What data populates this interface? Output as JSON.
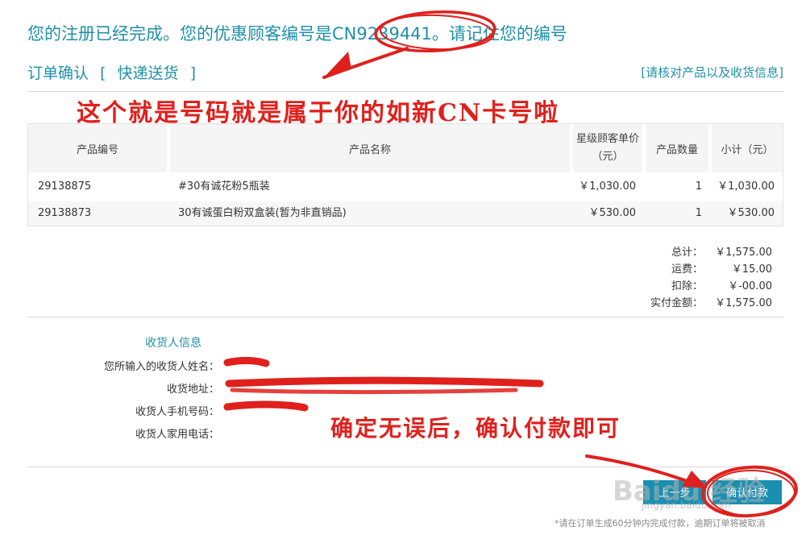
{
  "header": {
    "registration_notice": "您的注册已经完成。您的优惠顾客编号是CN9239441。请记住您的编号",
    "order_confirm": "订单确认",
    "bracket_open": "[",
    "shipping_method": "快递送货",
    "bracket_close": "]",
    "verify_link": "[请核对产品以及收货信息]"
  },
  "annotations": {
    "top": "这个就是号码就是属于你的如新CN卡号啦",
    "bottom": "确定无误后，确认付款即可",
    "color": "#e0201c"
  },
  "table": {
    "headers": [
      "产品编号",
      "产品名称",
      "星级顾客单价",
      "（元）",
      "产品数量",
      "小计（元）"
    ],
    "rows": [
      {
        "code": "29138875",
        "name": "#30有诚花粉5瓶装",
        "price": "￥1,030.00",
        "qty": "1",
        "subtotal": "￥1,030.00"
      },
      {
        "code": "29138873",
        "name": "30有诚蛋白粉双盒装(暂为非直销品)",
        "price": "￥530.00",
        "qty": "1",
        "subtotal": "￥530.00"
      }
    ]
  },
  "summary": [
    {
      "label": "总计：",
      "value": "￥1,575.00"
    },
    {
      "label": "运费：",
      "value": "￥15.00"
    },
    {
      "label": "扣除：",
      "value": "￥-00.00"
    },
    {
      "label": "实付金额：",
      "value": "￥1,575.00"
    }
  ],
  "consignee": {
    "title": "收货人信息",
    "fields": [
      {
        "label": "您所输入的收货人姓名："
      },
      {
        "label": "收货地址："
      },
      {
        "label": "收货人手机号码："
      },
      {
        "label": "收货人家用电话："
      }
    ]
  },
  "buttons": {
    "prev": "上一步",
    "pay": "确认付款"
  },
  "watermark": {
    "main": "Baidu 经验",
    "sub": "jingyan.baidu.com"
  },
  "footer_note": "*请在订单生成60分钟内完成付款，逾期订单将被取消",
  "theme": {
    "accent": "#1f8fa8",
    "button": "#1a8fb0"
  }
}
